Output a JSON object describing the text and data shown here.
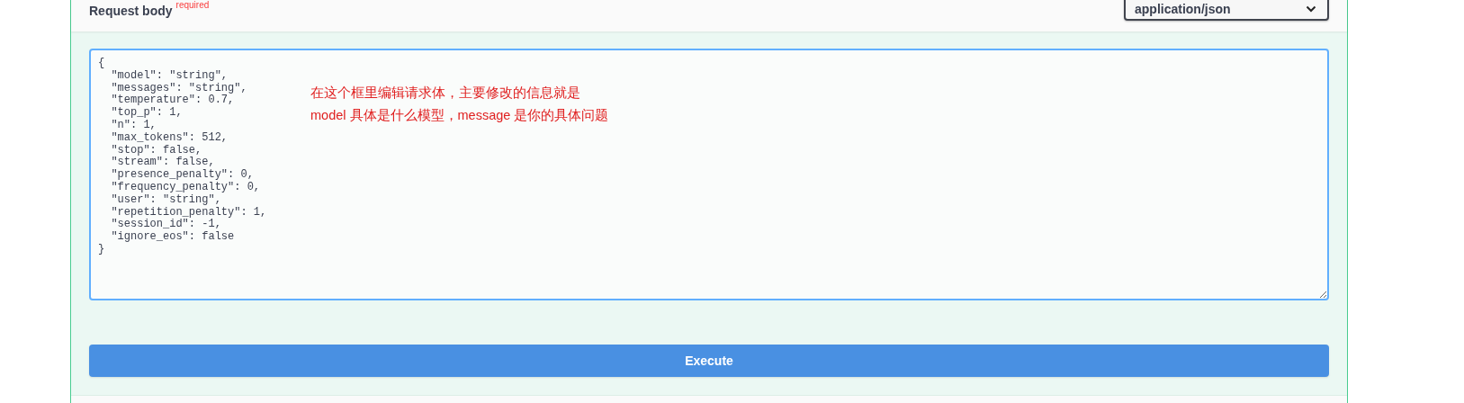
{
  "request_body": {
    "title": "Request body",
    "required_label": "required",
    "content_type": "application/json"
  },
  "editor": {
    "value": "{\n  \"model\": \"string\",\n  \"messages\": \"string\",\n  \"temperature\": 0.7,\n  \"top_p\": 1,\n  \"n\": 1,\n  \"max_tokens\": 512,\n  \"stop\": false,\n  \"stream\": false,\n  \"presence_penalty\": 0,\n  \"frequency_penalty\": 0,\n  \"user\": \"string\",\n  \"repetition_penalty\": 1,\n  \"session_id\": -1,\n  \"ignore_eos\": false\n}"
  },
  "annotation": {
    "lines": [
      "在这个框里编辑请求体，主要修改的信息就是",
      "model 具体是什么模型，message 是你的具体问题"
    ]
  },
  "execute_button": {
    "label": "Execute"
  }
}
